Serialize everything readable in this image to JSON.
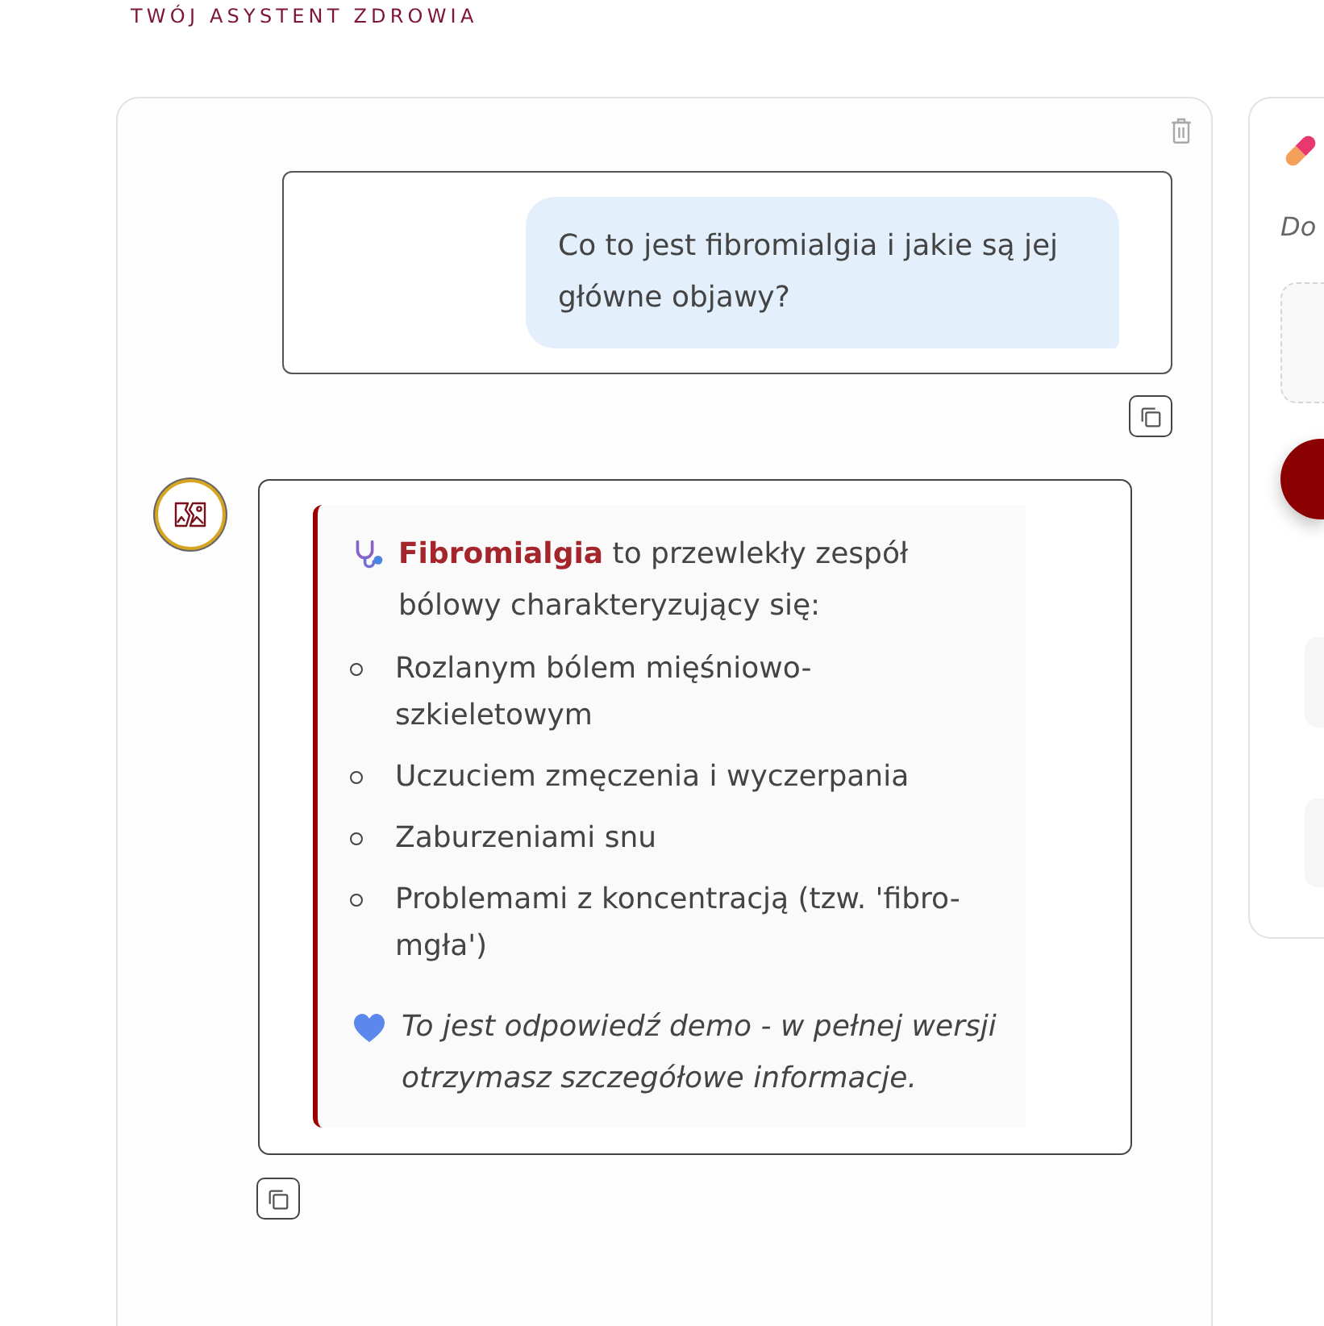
{
  "header": {
    "tagline": "TWÓJ ASYSTENT ZDROWIA"
  },
  "chat": {
    "messages": [
      {
        "kind": "user",
        "text": "Co to jest fibromialgia i jakie są jej główne objawy?"
      },
      {
        "kind": "assistant",
        "blocks": [
          {
            "kind": "intro",
            "text": "**Fibromialgia** to przewlekły zespół bólowy charakteryzujący się:"
          },
          {
            "kind": "list",
            "items": [
              "Rozlanym bólem mięśniowo-szkieletowym",
              "Uczuciem zmęczenia i wyczerpania",
              "Zaburzeniami snu",
              "Problemami z koncentracją (tzw. 'fibro-mgła')"
            ]
          },
          {
            "kind": "note",
            "text": "To jest odpowiedź demo - w pełnej wersji otrzymasz szczegółowe informacje."
          }
        ]
      }
    ]
  },
  "side_panel": {
    "caption": "Do"
  }
}
